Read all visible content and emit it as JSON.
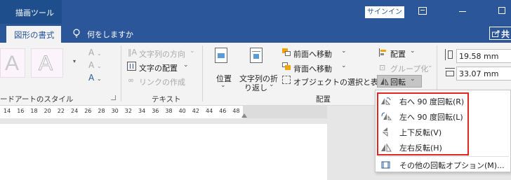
{
  "titlebar": {
    "context_tab": "描画ツール",
    "signin": "サインイン",
    "minimize_icon": "minimize-icon",
    "maximize_icon": "maximize-icon"
  },
  "tabs": {
    "format_tab": "図形の書式",
    "tellme": "何をしますか",
    "share": "共"
  },
  "ribbon": {
    "wordart_group": "ードアートのスタイル",
    "text_group": "テキスト",
    "text_direction": "文字列の方向",
    "text_align": "文字の配置",
    "create_link": "リンクの作成",
    "position": "位置",
    "wrap_text_line1": "文字列の折",
    "wrap_text_line2": "り返し",
    "bring_forward": "前面へ移動",
    "send_backward": "背面へ移動",
    "selection_pane": "オブジェクトの選択と表示",
    "arrange_group": "配置",
    "align": "配置",
    "group": "グループ化",
    "rotate": "回転",
    "height_value": "19.58 mm",
    "width_value": "33.07 mm"
  },
  "ruler": {
    "ticks": [
      "14",
      "16",
      "18",
      "20",
      "22",
      "24",
      "26",
      "28",
      "30",
      "32",
      "34",
      "36",
      "38",
      "40",
      "42",
      "44",
      "46",
      "48"
    ]
  },
  "rotate_menu": {
    "items": [
      {
        "label": "右へ 90 度回転(R)",
        "icon": "rotate-right-90-icon"
      },
      {
        "label": "左へ 90 度回転(L)",
        "icon": "rotate-left-90-icon"
      },
      {
        "label": "上下反転(V)",
        "icon": "flip-vertical-icon"
      },
      {
        "label": "左右反転(H)",
        "icon": "flip-horizontal-icon"
      },
      {
        "label": "その他の回転オプション(M)...",
        "icon": "more-rotation-options-icon"
      }
    ],
    "highlight_color": "#e0261f"
  },
  "colors": {
    "title_blue": "#2b579a",
    "ribbon_bg": "#f3f3f3",
    "accent_orange": "#f0a30a"
  }
}
